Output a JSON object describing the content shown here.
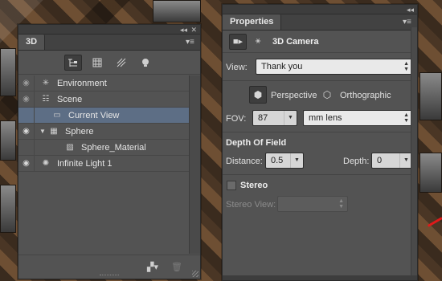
{
  "panel3d": {
    "tab_label": "3D",
    "items": [
      {
        "label": "Environment",
        "icon": "environment-icon",
        "visible": false,
        "selected": false
      },
      {
        "label": "Scene",
        "icon": "scene-icon",
        "visible": false,
        "selected": false
      },
      {
        "label": "Current View",
        "icon": "camera-icon",
        "visible": false,
        "selected": true
      },
      {
        "label": "Sphere",
        "icon": "mesh-icon",
        "visible": true,
        "selected": false,
        "expanded": true
      },
      {
        "label": "Sphere_Material",
        "icon": "material-icon",
        "visible": false,
        "selected": false
      },
      {
        "label": "Infinite Light 1",
        "icon": "light-icon",
        "visible": true,
        "selected": false
      }
    ]
  },
  "props": {
    "tab_label": "Properties",
    "title": "3D Camera",
    "view": {
      "label": "View:",
      "value": "Thank you"
    },
    "projection": {
      "perspective_label": "Perspective",
      "orthographic_label": "Orthographic",
      "selected": "perspective"
    },
    "fov": {
      "label": "FOV:",
      "value": "87",
      "unit": "mm lens"
    },
    "dof": {
      "title": "Depth Of Field",
      "distance_label": "Distance:",
      "distance_value": "0.5",
      "depth_label": "Depth:",
      "depth_value": "0"
    },
    "stereo": {
      "label": "Stereo",
      "checked": false,
      "view_label": "Stereo View:",
      "view_value": ""
    }
  },
  "colors": {
    "selection": "#5d6e85",
    "panel": "#535353",
    "field": "#e9e9e9"
  }
}
